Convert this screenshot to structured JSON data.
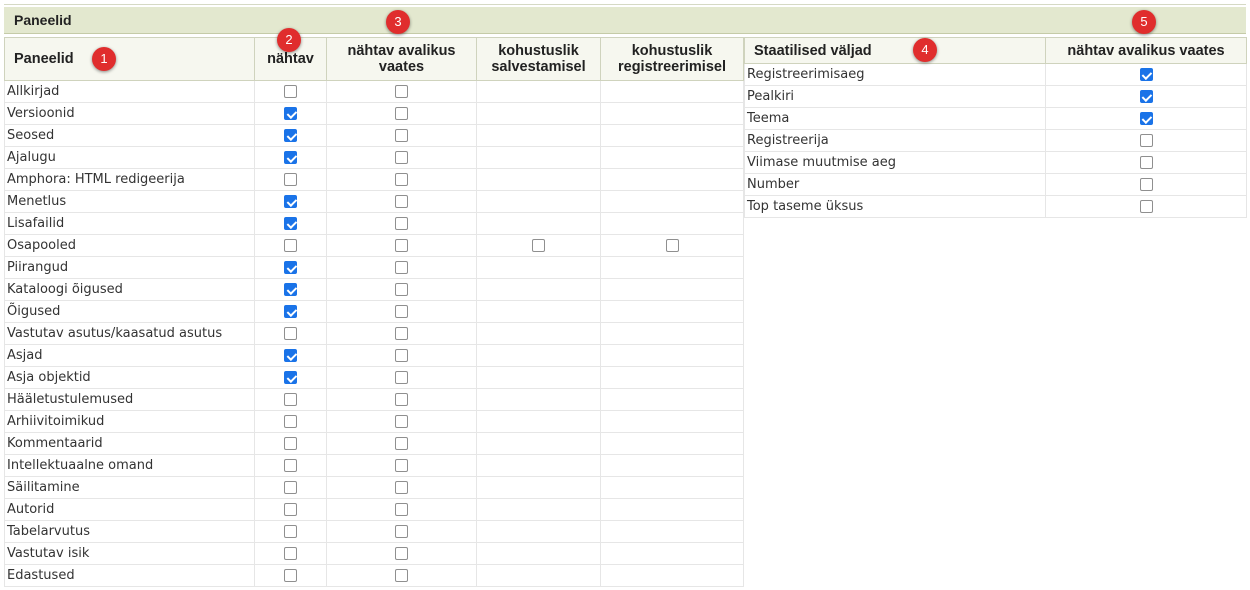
{
  "section_title": "Paneelid",
  "left_table": {
    "headers": {
      "name": "Paneelid",
      "visible": "nähtav",
      "public_line1": "nähtav avalikus",
      "public_line2": "vaates",
      "req_save_line1": "kohustuslik",
      "req_save_line2": "salvestamisel",
      "req_reg_line1": "kohustuslik",
      "req_reg_line2": "registreerimisel"
    },
    "rows": [
      {
        "label": "Allkirjad",
        "visible": false,
        "public": false
      },
      {
        "label": "Versioonid",
        "visible": true,
        "public": false
      },
      {
        "label": "Seosed",
        "visible": true,
        "public": false
      },
      {
        "label": "Ajalugu",
        "visible": true,
        "public": false
      },
      {
        "label": "Amphora: HTML redigeerija",
        "visible": false,
        "public": false
      },
      {
        "label": "Menetlus",
        "visible": true,
        "public": false
      },
      {
        "label": "Lisafailid",
        "visible": true,
        "public": false
      },
      {
        "label": "Osapooled",
        "visible": false,
        "public": false,
        "req_save": false,
        "req_reg": false
      },
      {
        "label": "Piirangud",
        "visible": true,
        "public": false
      },
      {
        "label": "Kataloogi õigused",
        "visible": true,
        "public": false
      },
      {
        "label": "Õigused",
        "visible": true,
        "public": false
      },
      {
        "label": "Vastutav asutus/kaasatud asutus",
        "visible": false,
        "public": false
      },
      {
        "label": "Asjad",
        "visible": true,
        "public": false
      },
      {
        "label": "Asja objektid",
        "visible": true,
        "public": false
      },
      {
        "label": "Hääletustulemused",
        "visible": false,
        "public": false
      },
      {
        "label": "Arhiivitoimikud",
        "visible": false,
        "public": false
      },
      {
        "label": "Kommentaarid",
        "visible": false,
        "public": false
      },
      {
        "label": "Intellektuaalne omand",
        "visible": false,
        "public": false
      },
      {
        "label": "Säilitamine",
        "visible": false,
        "public": false
      },
      {
        "label": "Autorid",
        "visible": false,
        "public": false
      },
      {
        "label": "Tabelarvutus",
        "visible": false,
        "public": false
      },
      {
        "label": "Vastutav isik",
        "visible": false,
        "public": false
      },
      {
        "label": "Edastused",
        "visible": false,
        "public": false
      }
    ]
  },
  "right_table": {
    "headers": {
      "name": "Staatilised väljad",
      "public": "nähtav avalikus vaates"
    },
    "rows": [
      {
        "label": "Registreerimisaeg",
        "public": true
      },
      {
        "label": "Pealkiri",
        "public": true
      },
      {
        "label": "Teema",
        "public": true
      },
      {
        "label": "Registreerija",
        "public": false
      },
      {
        "label": "Viimase muutmise aeg",
        "public": false
      },
      {
        "label": "Number",
        "public": false
      },
      {
        "label": "Top taseme üksus",
        "public": false
      }
    ]
  },
  "badges": [
    "1",
    "2",
    "3",
    "4",
    "5"
  ],
  "colors": {
    "section_bar": "#e3e8cf",
    "header_bg": "#f6f7ef",
    "checkbox_checked": "#1a73e8",
    "badge": "#e02d2d"
  }
}
